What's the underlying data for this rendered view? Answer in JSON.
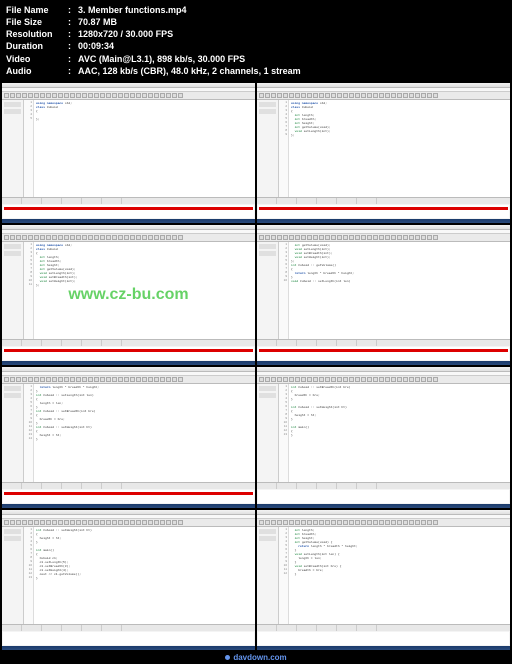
{
  "info": [
    {
      "label": "File Name",
      "value": "3. Member functions.mp4"
    },
    {
      "label": "File Size",
      "value": "70.87 MB"
    },
    {
      "label": "Resolution",
      "value": "1280x720 / 30.000 FPS"
    },
    {
      "label": "Duration",
      "value": "00:09:34"
    },
    {
      "label": "Video",
      "value": "AVC (Main@L3.1), 898 kb/s, 30.000 FPS"
    },
    {
      "label": "Audio",
      "value": "AAC, 128 kb/s (CBR), 48.0 kHz, 2 channels, 1 stream"
    }
  ],
  "watermark": "www.cz-bu.com",
  "footer_text": "davdown.com",
  "shots": [
    {
      "code": [
        {
          "t": "using namespace",
          "cls": "kw",
          "post": " std;"
        },
        {
          "t": "class",
          "cls": "kw",
          "post": " Cuboid"
        },
        {
          "t": "{",
          "cls": ""
        },
        {
          "t": "",
          "cls": ""
        },
        {
          "t": "};",
          "cls": ""
        }
      ],
      "red": true
    },
    {
      "code": [
        {
          "t": "using namespace",
          "cls": "kw",
          "post": " std;"
        },
        {
          "t": "class",
          "cls": "kw",
          "post": " Cuboid"
        },
        {
          "t": "{",
          "cls": ""
        },
        {
          "t": "  int",
          "cls": "ty",
          "post": " length;"
        },
        {
          "t": "  int",
          "cls": "ty",
          "post": " breadth;"
        },
        {
          "t": "  int",
          "cls": "ty",
          "post": " height;"
        },
        {
          "t": "  int",
          "cls": "ty",
          "post": " getVolume(void);"
        },
        {
          "t": "  void",
          "cls": "ty",
          "post": " setLength(int);"
        },
        {
          "t": "};",
          "cls": ""
        }
      ],
      "red": true
    },
    {
      "code": [
        {
          "t": "using namespace",
          "cls": "kw",
          "post": " std;"
        },
        {
          "t": "class",
          "cls": "kw",
          "post": " Cuboid"
        },
        {
          "t": "{",
          "cls": ""
        },
        {
          "t": "  int",
          "cls": "ty",
          "post": " length;"
        },
        {
          "t": "  int",
          "cls": "ty",
          "post": " breadth;"
        },
        {
          "t": "  int",
          "cls": "ty",
          "post": " height;"
        },
        {
          "t": "  int",
          "cls": "ty",
          "post": " getVolume(void);"
        },
        {
          "t": "  void",
          "cls": "ty",
          "post": " setLength(int);"
        },
        {
          "t": "  void",
          "cls": "ty",
          "post": " setBreadth(int);"
        },
        {
          "t": "  void",
          "cls": "ty",
          "post": " setHeight(int);"
        },
        {
          "t": "};",
          "cls": ""
        }
      ],
      "red": true,
      "wm": true
    },
    {
      "code": [
        {
          "t": "  int",
          "cls": "ty",
          "post": " getVolume(void);"
        },
        {
          "t": "  void",
          "cls": "ty",
          "post": " setLength(int);"
        },
        {
          "t": "  void",
          "cls": "ty",
          "post": " setBreadth(int);"
        },
        {
          "t": "  void",
          "cls": "ty",
          "post": " setHeight(int);"
        },
        {
          "t": "};",
          "cls": ""
        },
        {
          "t": "int",
          "cls": "ty",
          "post": " Cuboid :: getVolume()"
        },
        {
          "t": "{",
          "cls": ""
        },
        {
          "t": "  return",
          "cls": "kw",
          "post": " length * breadth * height;"
        },
        {
          "t": "}",
          "cls": ""
        },
        {
          "t": "void",
          "cls": "ty",
          "post": " Cuboid :: setLength(int len)"
        }
      ],
      "red": true
    },
    {
      "code": [
        {
          "t": "  return",
          "cls": "kw",
          "post": " length * breadth * height;"
        },
        {
          "t": "}",
          "cls": ""
        },
        {
          "t": "int",
          "cls": "ty",
          "post": " Cuboid :: setLength(int len)"
        },
        {
          "t": "{",
          "cls": ""
        },
        {
          "t": "  length = len;",
          "cls": ""
        },
        {
          "t": "}",
          "cls": ""
        },
        {
          "t": "int",
          "cls": "ty",
          "post": " Cuboid :: setBreadth(int bre)"
        },
        {
          "t": "{",
          "cls": ""
        },
        {
          "t": "  breadth = bre;",
          "cls": ""
        },
        {
          "t": "}",
          "cls": ""
        },
        {
          "t": "int",
          "cls": "ty",
          "post": " Cuboid :: setHeight(int ht)"
        },
        {
          "t": "{",
          "cls": ""
        },
        {
          "t": "  height = ht;",
          "cls": ""
        },
        {
          "t": "}",
          "cls": ""
        }
      ],
      "red": true
    },
    {
      "code": [
        {
          "t": "int",
          "cls": "ty",
          "post": " Cuboid :: setBreadth(int bre)"
        },
        {
          "t": "{",
          "cls": ""
        },
        {
          "t": "  breadth = bre;",
          "cls": ""
        },
        {
          "t": "}",
          "cls": ""
        },
        {
          "t": "",
          "cls": ""
        },
        {
          "t": "int",
          "cls": "ty",
          "post": " Cuboid :: setHeight(int ht)"
        },
        {
          "t": "{",
          "cls": ""
        },
        {
          "t": "  height = ht;",
          "cls": ""
        },
        {
          "t": "}",
          "cls": ""
        },
        {
          "t": "",
          "cls": ""
        },
        {
          "t": "int",
          "cls": "ty",
          "post": " main()"
        },
        {
          "t": "{",
          "cls": ""
        },
        {
          "t": "}",
          "cls": ""
        }
      ],
      "red": false
    },
    {
      "code": [
        {
          "t": "int",
          "cls": "ty",
          "post": " Cuboid :: setHeight(int ht)"
        },
        {
          "t": "{",
          "cls": ""
        },
        {
          "t": "  height = ht;",
          "cls": ""
        },
        {
          "t": "}",
          "cls": ""
        },
        {
          "t": "",
          "cls": ""
        },
        {
          "t": "int",
          "cls": "ty",
          "post": " main()"
        },
        {
          "t": "{",
          "cls": ""
        },
        {
          "t": "  Cuboid c1;",
          "cls": ""
        },
        {
          "t": "  c1.setLength(5);",
          "cls": ""
        },
        {
          "t": "  c1.setBreadth(3);",
          "cls": ""
        },
        {
          "t": "  c1.setHeight(4);",
          "cls": ""
        },
        {
          "t": "  cout << c1.getVolume();",
          "cls": ""
        },
        {
          "t": "}",
          "cls": ""
        }
      ],
      "red": false
    },
    {
      "code": [
        {
          "t": "  int",
          "cls": "ty",
          "post": " length;"
        },
        {
          "t": "  int",
          "cls": "ty",
          "post": " breadth;"
        },
        {
          "t": "  int",
          "cls": "ty",
          "post": " height;"
        },
        {
          "t": "  int",
          "cls": "ty",
          "post": " getVolume(void) {"
        },
        {
          "t": "    return",
          "cls": "kw",
          "post": " length * breadth * height;"
        },
        {
          "t": "  }",
          "cls": ""
        },
        {
          "t": "  void",
          "cls": "ty",
          "post": " setLength(int len) {"
        },
        {
          "t": "    length = len;",
          "cls": ""
        },
        {
          "t": "  }",
          "cls": ""
        },
        {
          "t": "  void",
          "cls": "ty",
          "post": " setBreadth(int bre) {"
        },
        {
          "t": "    breadth = bre;",
          "cls": ""
        },
        {
          "t": "  }",
          "cls": ""
        }
      ],
      "red": false
    }
  ]
}
